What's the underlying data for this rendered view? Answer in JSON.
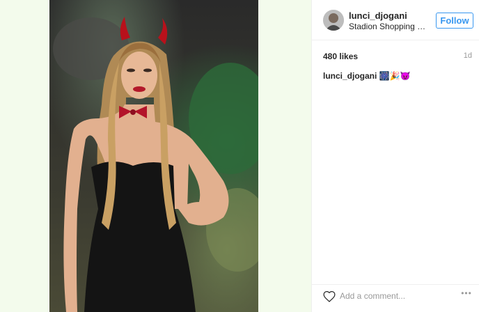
{
  "post": {
    "image_icon": "photo-of-woman-in-devil-costume",
    "username": "lunci_djogani",
    "location": "Stadion Shopping Ce...",
    "follow_label": "Follow",
    "likes": "480 likes",
    "time_ago": "1d",
    "caption_user": "lunci_djogani",
    "caption_text": "🎆🎉😈",
    "comment_placeholder": "Add a comment...",
    "more_label": "•••"
  },
  "colors": {
    "accent": "#3897f0",
    "text": "#262626",
    "muted": "#999999",
    "panel_bg": "#f3fbec"
  },
  "icons": {
    "like": "heart-icon",
    "more": "more-options-icon"
  }
}
